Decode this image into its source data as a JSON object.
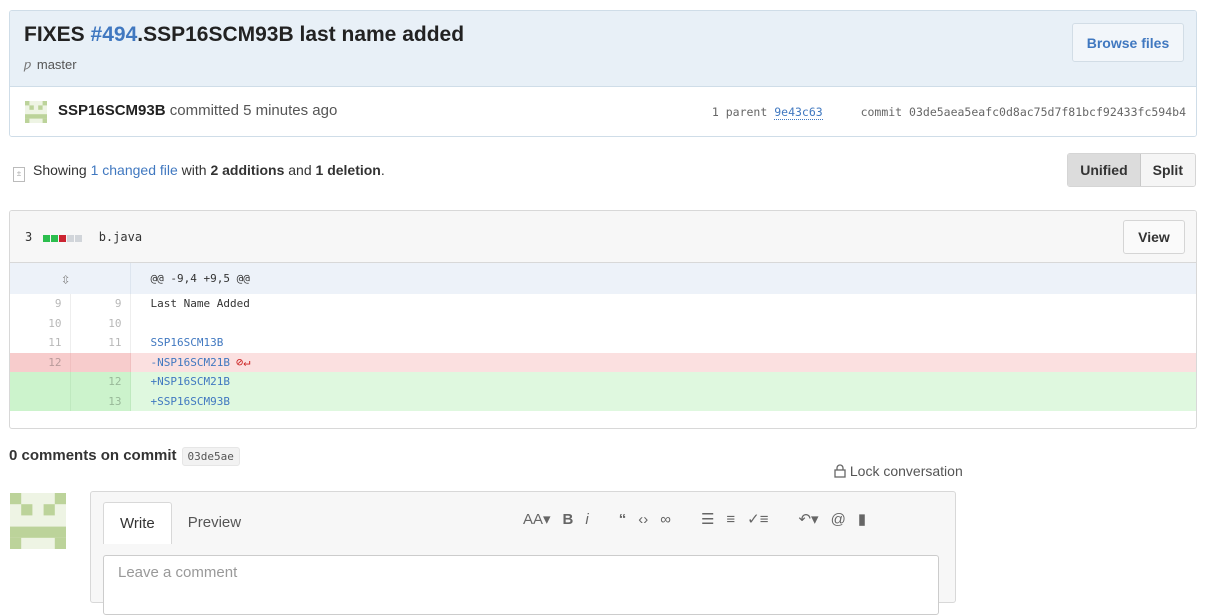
{
  "commit": {
    "title_prefix": "FIXES ",
    "issue_ref": "#494",
    "title_rest": ".SSP16SCM93B last name added",
    "branch": "master",
    "browse_label": "Browse files",
    "author": "SSP16SCM93B",
    "committed_text": " committed 5 minutes ago",
    "parent_label": "1 parent",
    "parent_sha": "9e43c63",
    "commit_label": "commit",
    "commit_sha": "03de5aea5eafc0d8ac75d7f81bcf92433fc594b4"
  },
  "summary": {
    "showing": "Showing ",
    "changed": "1 changed file",
    "with": " with ",
    "additions": "2 additions",
    "and": " and ",
    "deletions": "1 deletion",
    "period": ".",
    "unified_label": "Unified",
    "split_label": "Split"
  },
  "file": {
    "change_count": "3",
    "name": "b.java",
    "view_label": "View",
    "hunk": "@@ -9,4 +9,5 @@",
    "lines": [
      {
        "old": "9",
        "new": "9",
        "text": " Last Name Added",
        "type": "context"
      },
      {
        "old": "10",
        "new": "10",
        "text": "",
        "type": "context"
      },
      {
        "old": "11",
        "new": "11",
        "text": " SSP16SCM13B",
        "type": "context-blue"
      },
      {
        "old": "12",
        "new": "",
        "text": "-NSP16SCM21B",
        "type": "del"
      },
      {
        "old": "",
        "new": "12",
        "text": "+NSP16SCM21B",
        "type": "add"
      },
      {
        "old": "",
        "new": "13",
        "text": "+SSP16SCM93B",
        "type": "add"
      }
    ]
  },
  "comments": {
    "count_title": "0 comments on commit",
    "short_sha": "03de5ae",
    "lock_label": "Lock conversation",
    "write_tab": "Write",
    "preview_tab": "Preview",
    "placeholder": "Leave a comment"
  },
  "colors": {
    "link": "#4078c0",
    "added_block": "#2cbe4e",
    "deleted_block": "#cb2431",
    "neutral_block": "#d1d5da"
  }
}
